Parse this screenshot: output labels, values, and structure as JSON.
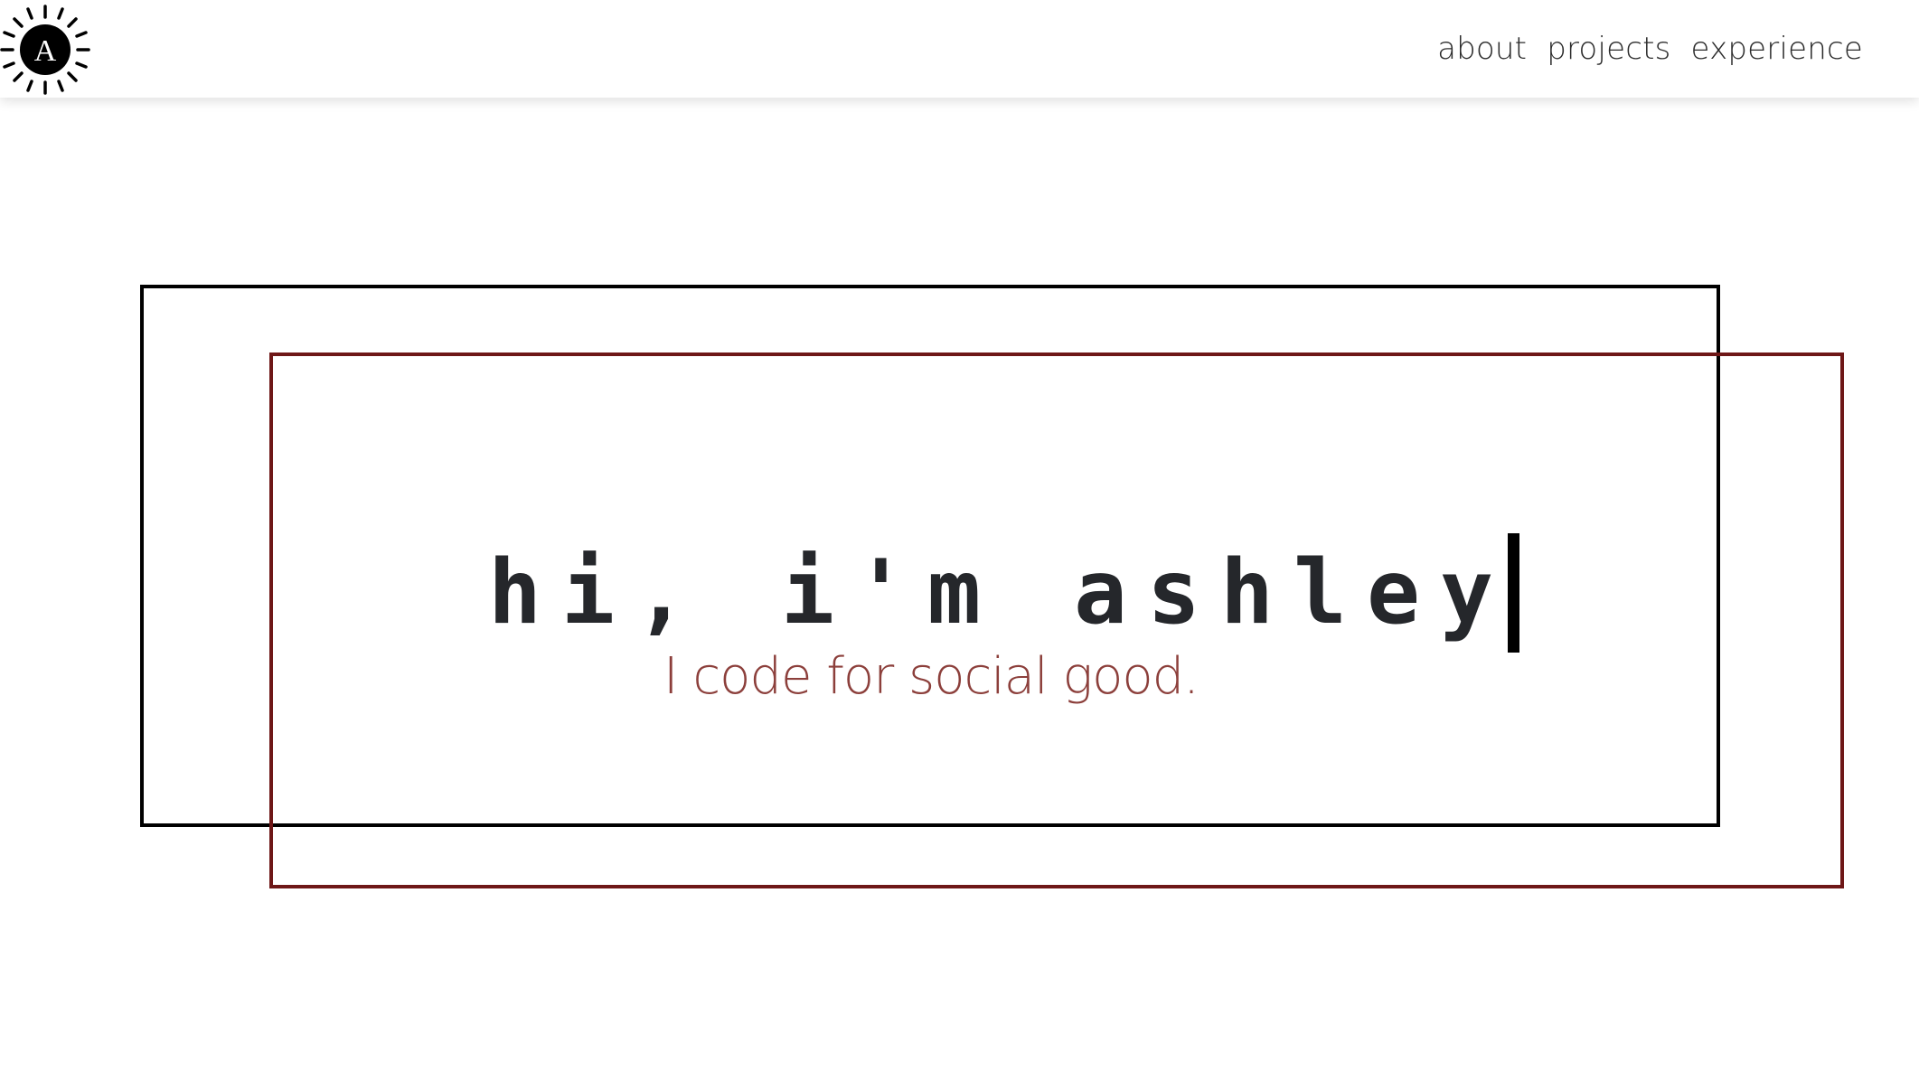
{
  "brand": {
    "logo_letter": "A",
    "logo_icon": "sun-icon"
  },
  "nav": {
    "items": [
      {
        "label": "about"
      },
      {
        "label": "projects"
      },
      {
        "label": "experience"
      }
    ]
  },
  "hero": {
    "title": "hi, i'm ashley",
    "subtitle": "I code for social good."
  },
  "colors": {
    "title": "#25272b",
    "subtitle": "#8c3f3b",
    "frame_black": "#000000",
    "frame_red": "#6e1717",
    "background": "#ffffff"
  }
}
